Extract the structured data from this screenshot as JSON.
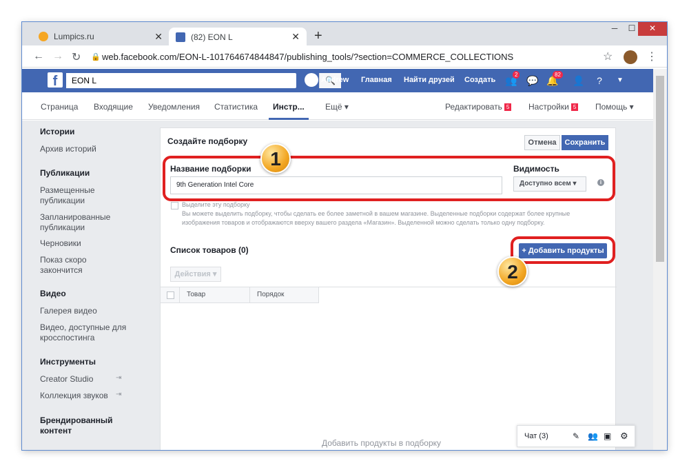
{
  "browser": {
    "tabs": [
      {
        "title": "Lumpics.ru",
        "close": "✕"
      },
      {
        "title": "(82) EON L",
        "close": "✕"
      }
    ],
    "new_tab": "+",
    "window_controls": {
      "minimize": "─",
      "maximize": "☐",
      "close": "✕"
    },
    "nav": {
      "back": "←",
      "forward": "→",
      "reload": "↻"
    },
    "url": "web.facebook.com/EON-L-101764674844847/publishing_tools/?section=COMMERCE_COLLECTIONS",
    "star": "☆",
    "menu": "⋮"
  },
  "fb_header": {
    "search_value": "EON L",
    "user": "Andrew",
    "links": [
      "Главная",
      "Найти друзей",
      "Создать"
    ],
    "friends_badge": "2",
    "notif_badge": "82"
  },
  "page_nav": {
    "items": [
      "Страница",
      "Входящие",
      "Уведомления",
      "Статистика",
      "Инстр...",
      "Ещё ▾"
    ],
    "edit": "Редактировать",
    "edit_badge": "5",
    "settings": "Настройки",
    "settings_badge": "5",
    "help": "Помощь ▾"
  },
  "sidebar": {
    "sections": [
      {
        "heading": "Истории",
        "items": [
          "Архив историй"
        ]
      },
      {
        "heading": "Публикации",
        "items": [
          "Размещенные публикации",
          "Запланированные публикации",
          "Черновики",
          "Показ скоро закончится"
        ]
      },
      {
        "heading": "Видео",
        "items": [
          "Галерея видео",
          "Видео, доступные для кросспостинга"
        ]
      },
      {
        "heading": "Инструменты",
        "items": [
          "Creator Studio",
          "Коллекция звуков"
        ]
      },
      {
        "heading": "Брендированный контент",
        "items": []
      }
    ]
  },
  "form": {
    "title": "Создайте подборку",
    "cancel": "Отмена",
    "save": "Сохранить",
    "name_label": "Название подборки",
    "name_value": "9th Generation Intel Core",
    "visibility_label": "Видимость",
    "visibility_value": "Доступно всем ▾",
    "feature_label": "Выделите эту подборку",
    "feature_desc": "Вы можете выделить подборку, чтобы сделать ее более заметной в вашем магазине. Выделенные подборки содержат более крупные изображения товаров и отображаются вверху вашего раздела «Магазин». Выделенной можно сделать только одну подборку.",
    "products_heading": "Список товаров (0)",
    "add_products": "+ Добавить продукты",
    "actions": "Действия ▾",
    "columns": [
      "Товар",
      "Порядок"
    ],
    "empty_text": "Добавить продукты в подборку"
  },
  "annotations": {
    "step1": "1",
    "step2": "2"
  },
  "chat": {
    "label": "Чат (3)"
  },
  "colors": {
    "fb_blue": "#4267b2",
    "highlight_red": "#e02020",
    "badge_red": "#f02849"
  }
}
